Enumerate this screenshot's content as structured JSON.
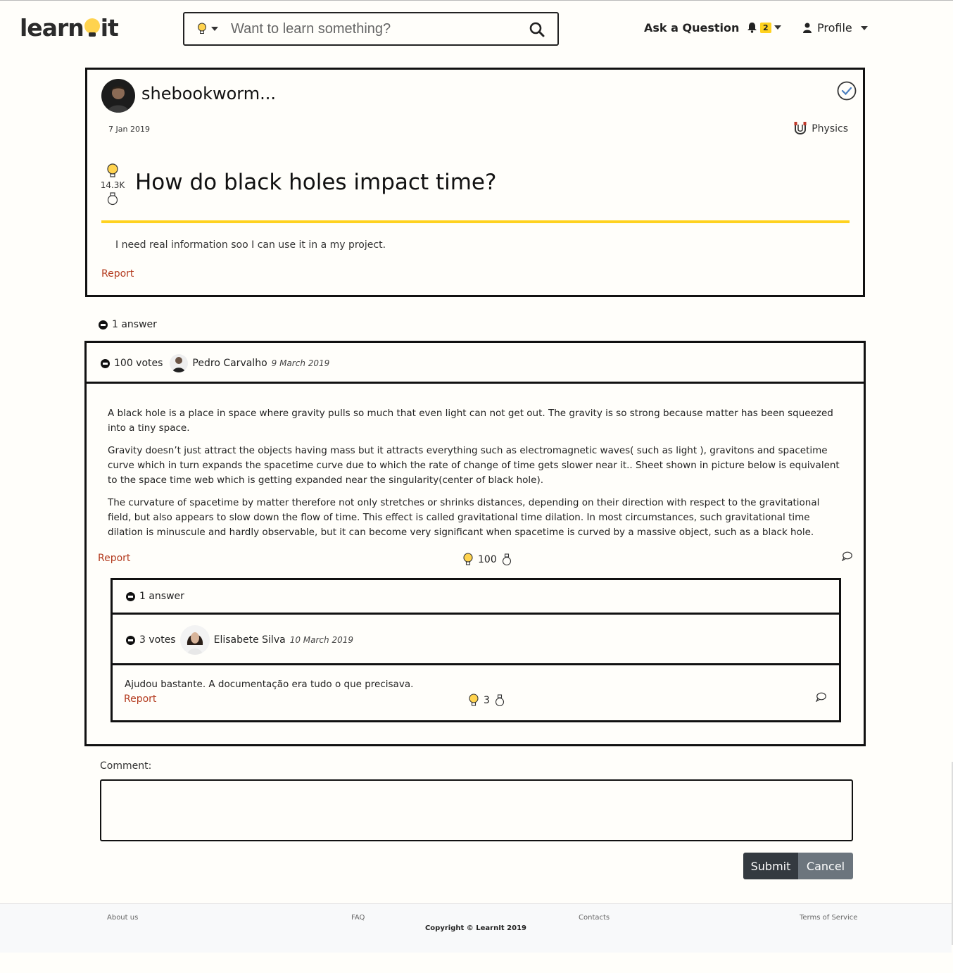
{
  "header": {
    "logo_text_1": "learn",
    "logo_text_2": "it",
    "search_placeholder": "Want to learn something?",
    "ask_label": "Ask a Question",
    "notifications_count": "2",
    "profile_label": "Profile"
  },
  "question": {
    "username": "shebookworm...",
    "date": "7 Jan 2019",
    "category": "Physics",
    "votes": "14.3K",
    "title": "How do black holes impact time?",
    "body": "I need real information soo I can use it in a my project.",
    "report_label": "Report",
    "accent_color": "#ffd21f"
  },
  "answers_count_label": "1 answer",
  "answer": {
    "votes_label": "100 votes",
    "author": "Pedro Carvalho",
    "date": "9 March 2019",
    "paragraphs": [
      "A black hole is a place in space where gravity pulls so much that even light can not get out. The gravity is so strong because matter has been squeezed into a tiny space.",
      "Gravity doesn’t just attract the objects having mass but it attracts everything such as electromagnetic waves( such as light ), gravitons and spacetime curve which in turn expands the spacetime curve due to which the rate of change of time gets slower near it.. Sheet shown in picture below is equivalent to the space time web which is getting expanded near the singularity(center of black hole).",
      "The curvature of spacetime by matter therefore not only stretches or shrinks distances, depending on their direction with respect to the gravitational field, but also appears to slow down the flow of time. This effect is called gravitational time dilation. In most circumstances, such gravitational time dilation is minuscule and hardly observable, but it can become very significant when spacetime is curved by a massive object, such as a black hole."
    ],
    "report_label": "Report",
    "vote_count": "100",
    "replies_count_label": "1 answer",
    "reply": {
      "votes_label": "3 votes",
      "author": "Elisabete Silva",
      "date": "10 March 2019",
      "body": "Ajudou bastante. A documentação era tudo o que precisava.",
      "report_label": "Report",
      "vote_count": "3"
    }
  },
  "comment_form": {
    "label": "Comment:",
    "submit_label": "Submit",
    "cancel_label": "Cancel"
  },
  "footer": {
    "about": "About us",
    "faq": "FAQ",
    "contacts": "Contacts",
    "terms": "Terms of Service",
    "copyright": "Copyright © LearnIt 2019"
  }
}
